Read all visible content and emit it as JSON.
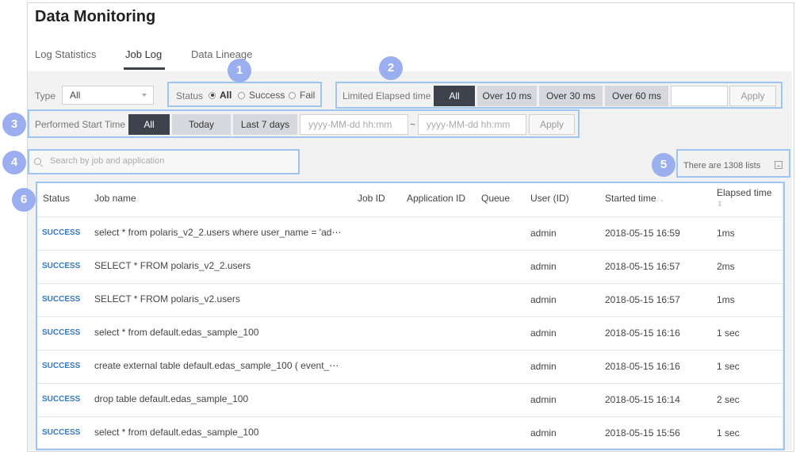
{
  "page": {
    "title": "Data Monitoring",
    "tabs": [
      {
        "label": "Log Statistics"
      },
      {
        "label": "Job Log"
      },
      {
        "label": "Data Lineage"
      }
    ]
  },
  "filters": {
    "type_label": "Type",
    "type_value": "All",
    "status_label": "Status",
    "status_options": [
      "All",
      "Success",
      "Fail"
    ],
    "elapsed_label": "Limited Elapsed time",
    "elapsed_buttons": [
      "All",
      "Over 10 ms",
      "Over 30 ms",
      "Over 60 ms"
    ],
    "elapsed_apply": "Apply",
    "start_label": "Performed Start Time",
    "start_buttons": [
      "All",
      "Today",
      "Last 7 days"
    ],
    "date_from_placeholder": "yyyy-MM-dd hh:mm",
    "date_separator": "~",
    "date_to_placeholder": "yyyy-MM-dd hh:mm",
    "start_apply": "Apply"
  },
  "search": {
    "placeholder": "Search by job and application"
  },
  "list_count": "There are 1308 lists",
  "badges": [
    "1",
    "2",
    "3",
    "4",
    "5",
    "6"
  ],
  "table": {
    "headers": [
      "Status",
      "Job name",
      "Job ID",
      "Application ID",
      "Queue",
      "User (ID)",
      "Started time",
      "Elapsed time"
    ],
    "rows": [
      {
        "status": "SUCCESS",
        "job": "select * from polaris_v2_2.users where user_name = 'ad⋯",
        "user": "admin",
        "started": "2018-05-15 16:59",
        "elapsed": "1ms"
      },
      {
        "status": "SUCCESS",
        "job": "SELECT * FROM polaris_v2_2.users",
        "user": "admin",
        "started": "2018-05-15 16:57",
        "elapsed": "2ms"
      },
      {
        "status": "SUCCESS",
        "job": "SELECT * FROM polaris_v2.users",
        "user": "admin",
        "started": "2018-05-15 16:57",
        "elapsed": "1ms"
      },
      {
        "status": "SUCCESS",
        "job": "select * from default.edas_sample_100",
        "user": "admin",
        "started": "2018-05-15 16:16",
        "elapsed": "1 sec"
      },
      {
        "status": "SUCCESS",
        "job": "create external table default.edas_sample_100 ( event_⋯",
        "user": "admin",
        "started": "2018-05-15 16:16",
        "elapsed": "1 sec"
      },
      {
        "status": "SUCCESS",
        "job": "drop table default.edas_sample_100",
        "user": "admin",
        "started": "2018-05-15 16:14",
        "elapsed": "2 sec"
      },
      {
        "status": "SUCCESS",
        "job": "select * from default.edas_sample_100",
        "user": "admin",
        "started": "2018-05-15 15:56",
        "elapsed": "1 sec"
      }
    ]
  }
}
